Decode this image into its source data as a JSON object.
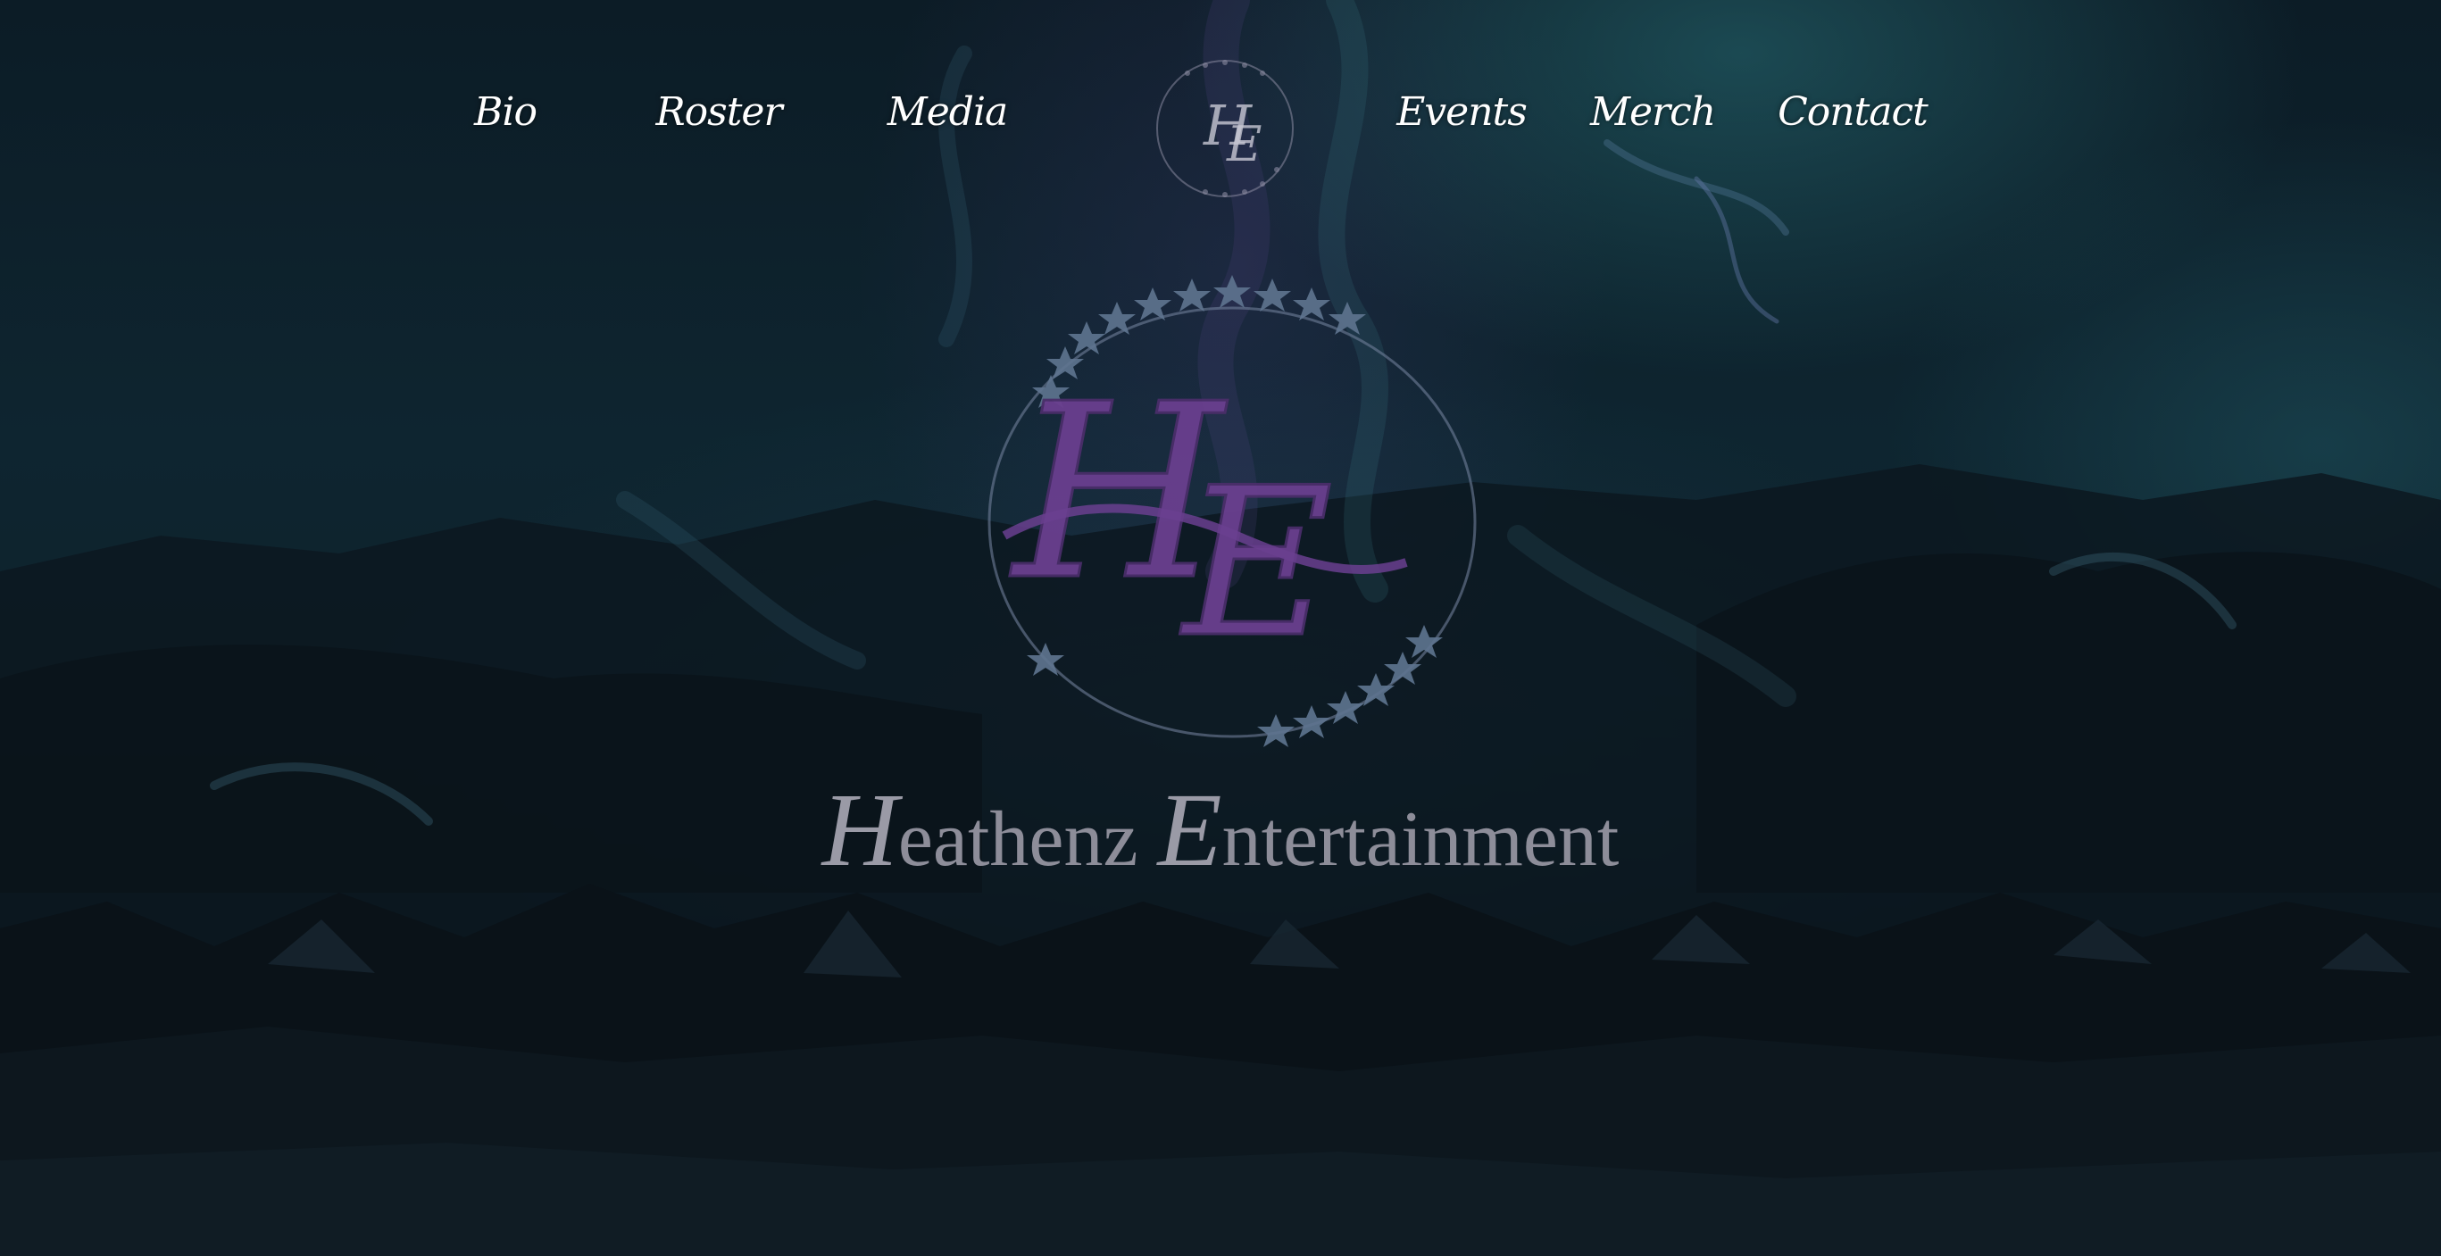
{
  "nav": {
    "items": [
      {
        "label": "Bio"
      },
      {
        "label": "Roster"
      },
      {
        "label": "Media"
      },
      {
        "label": "Events"
      },
      {
        "label": "Merch"
      },
      {
        "label": "Contact"
      }
    ],
    "logo_icon": "he-monogram-icon"
  },
  "hero": {
    "emblem_icon": "he-monogram-star-wreath-icon",
    "title_first_cap": "H",
    "title_first_rest": "eathenz ",
    "title_second_cap": "E",
    "title_second_rest": "ntertainment"
  },
  "colors": {
    "monogram_purple": "#6a3f8f",
    "title_gray": "#8d8d99",
    "nav_text": "#ffffff",
    "background": "#0e2530"
  }
}
